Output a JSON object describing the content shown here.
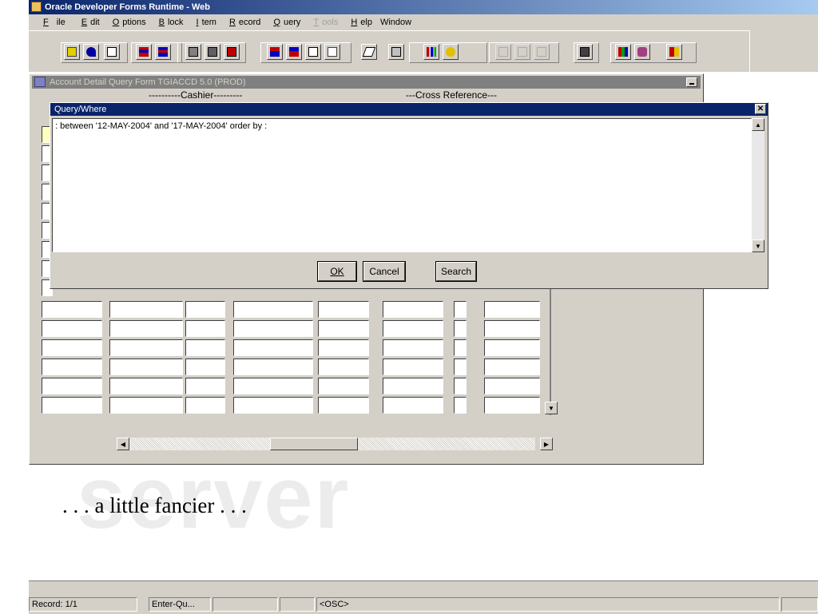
{
  "window": {
    "title": "Oracle Developer Forms Runtime - Web"
  },
  "menu": [
    {
      "label": "File",
      "disabled": false
    },
    {
      "label": "Edit",
      "disabled": false
    },
    {
      "label": "Options",
      "disabled": false
    },
    {
      "label": "Block",
      "disabled": false
    },
    {
      "label": "Item",
      "disabled": false
    },
    {
      "label": "Record",
      "disabled": false
    },
    {
      "label": "Query",
      "disabled": false
    },
    {
      "label": "Tools",
      "disabled": true
    },
    {
      "label": "Help",
      "disabled": false
    },
    {
      "label": "Window",
      "disabled": false
    }
  ],
  "toolbar_icons": [
    "save-icon",
    "undo-icon",
    "exit-icon",
    "insert-record-icon",
    "remove-record-icon",
    "previous-block-icon",
    "next-block-icon",
    "delete-record-icon",
    "previous-record-icon",
    "next-record-icon",
    "copy-icon",
    "paste-icon",
    "edit-icon",
    "print-icon",
    "chart-icon",
    "spreadsheet-icon",
    "tree-icon-1",
    "tree-icon-2",
    "tree-icon-3",
    "window-icon",
    "books-icon",
    "help-icon",
    "exit-door-icon"
  ],
  "form": {
    "title": "Account Detail Query Form  TGIACCD  5.0  (PROD)",
    "cashier_label": "----------Cashier---------",
    "cross_reference_label": "---Cross Reference---"
  },
  "dialog": {
    "title": "Query/Where",
    "query_text": ": between '12-MAY-2004' and '17-MAY-2004' order by :",
    "buttons": {
      "ok": "OK",
      "cancel": "Cancel",
      "search": "Search"
    }
  },
  "slide": {
    "caption": ". . . a little fancier . . .",
    "watermark": "server"
  },
  "status": {
    "record": "Record: 1/1",
    "mode": "Enter-Qu...",
    "osc": "<OSC>"
  }
}
